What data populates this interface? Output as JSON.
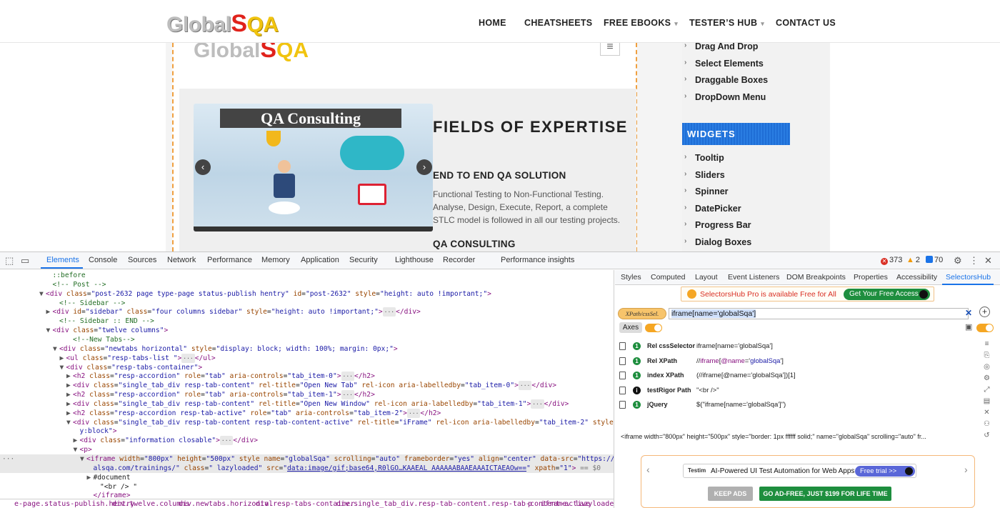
{
  "site": {
    "logo": {
      "part1": "Global",
      "part2": "S",
      "part3": "QA"
    },
    "nav": [
      {
        "label": "HOME",
        "dropdown": false
      },
      {
        "label": "CHEATSHEETS",
        "dropdown": false
      },
      {
        "label": "FREE EBOOKS",
        "dropdown": true
      },
      {
        "label": "TESTER’S HUB",
        "dropdown": true
      },
      {
        "label": "CONTACT US",
        "dropdown": false
      }
    ],
    "menu_glyph": "≡",
    "slider_title": "QA Consulting",
    "slider_prev": "‹",
    "slider_next": "›",
    "heading_fields": "FIELDS OF EXPERTISE",
    "heading_end": "END TO END QA SOLUTION",
    "para_end": "Functional Testing to Non-Functional Testing. Analyse, Design, Execute, Report, a complete STLC model is followed in all our testing projects.",
    "heading_qac": "QA CONSULTING",
    "sidebar_items_top": [
      "Drag And Drop",
      "Select Elements",
      "Draggable Boxes",
      "DropDown Menu"
    ],
    "widgets_heading": "WIDGETS",
    "sidebar_items_widgets": [
      "Tooltip",
      "Sliders",
      "Spinner",
      "DatePicker",
      "Progress Bar",
      "Dialog Boxes"
    ]
  },
  "devtools": {
    "tabs": [
      "Elements",
      "Console",
      "Sources",
      "Network",
      "Performance",
      "Memory",
      "Application",
      "Security",
      "Lighthouse",
      "Recorder",
      "Performance insights"
    ],
    "active_tab": "Elements",
    "errors": "373",
    "warnings": "2",
    "infos": "70",
    "code_lines": [
      {
        "indent": 7,
        "tri": "",
        "html": "<span class='cm'>::before</span>"
      },
      {
        "indent": 7,
        "tri": "",
        "html": "<span class='cm'>&lt;!-- Post --&gt;</span>"
      },
      {
        "indent": 6,
        "tri": "▼",
        "html": "<span class='tg'>&lt;div</span> <span class='an'>class</span>=<span class='av'>\"post-2632 page type-page status-publish hentry\"</span> <span class='an'>id</span>=<span class='av'>\"post-2632\"</span> <span class='an'>style</span>=<span class='av'>\"height: auto !important;\"</span><span class='tg'>&gt;</span>"
      },
      {
        "indent": 8,
        "tri": "",
        "html": "<span class='cm'>&lt;!-- Sidebar --&gt;</span>"
      },
      {
        "indent": 7,
        "tri": "▶",
        "html": "<span class='tg'>&lt;div</span> <span class='an'>id</span>=<span class='av'>\"sidebar\"</span> <span class='an'>class</span>=<span class='av'>\"four columns sidebar\"</span> <span class='an'>style</span>=<span class='av'>\"height: auto !important;\"</span><span class='tg'>&gt;</span><span class='el-dots'>···</span><span class='tg'>&lt;/div&gt;</span>"
      },
      {
        "indent": 8,
        "tri": "",
        "html": "<span class='cm'>&lt;!-- Sidebar :: END --&gt;</span>"
      },
      {
        "indent": 7,
        "tri": "▼",
        "html": "<span class='tg'>&lt;div</span> <span class='an'>class</span>=<span class='av'>\"twelve columns\"</span><span class='tg'>&gt;</span>"
      },
      {
        "indent": 10,
        "tri": "",
        "html": "<span class='cm'>&lt;!--New Tabs--&gt;</span>"
      },
      {
        "indent": 8,
        "tri": "▼",
        "html": "<span class='tg'>&lt;div</span> <span class='an'>class</span>=<span class='av'>\"newtabs horizontal\"</span> <span class='an'>style</span>=<span class='av'>\"display: block; width: 100%; margin: 0px;\"</span><span class='tg'>&gt;</span>"
      },
      {
        "indent": 9,
        "tri": "▶",
        "html": "<span class='tg'>&lt;ul</span> <span class='an'>class</span>=<span class='av'>\"resp-tabs-list \"</span><span class='tg'>&gt;</span><span class='el-dots'>···</span><span class='tg'>&lt;/ul&gt;</span>"
      },
      {
        "indent": 9,
        "tri": "▼",
        "html": "<span class='tg'>&lt;div</span> <span class='an'>class</span>=<span class='av'>\"resp-tabs-container\"</span><span class='tg'>&gt;</span>"
      },
      {
        "indent": 10,
        "tri": "▶",
        "html": "<span class='tg'>&lt;h2</span> <span class='an'>class</span>=<span class='av'>\"resp-accordion\"</span> <span class='an'>role</span>=<span class='av'>\"tab\"</span> <span class='an'>aria-controls</span>=<span class='av'>\"tab_item-0\"</span><span class='tg'>&gt;</span><span class='el-dots'>···</span><span class='tg'>&lt;/h2&gt;</span>"
      },
      {
        "indent": 10,
        "tri": "▶",
        "html": "<span class='tg'>&lt;div</span> <span class='an'>class</span>=<span class='av'>\"single_tab_div resp-tab-content\"</span> <span class='an'>rel-title</span>=<span class='av'>\"Open New Tab\"</span> <span class='an'>rel-icon</span> <span class='an'>aria-labelledby</span>=<span class='av'>\"tab_item-0\"</span><span class='tg'>&gt;</span><span class='el-dots'>···</span><span class='tg'>&lt;/div&gt;</span>"
      },
      {
        "indent": 10,
        "tri": "▶",
        "html": "<span class='tg'>&lt;h2</span> <span class='an'>class</span>=<span class='av'>\"resp-accordion\"</span> <span class='an'>role</span>=<span class='av'>\"tab\"</span> <span class='an'>aria-controls</span>=<span class='av'>\"tab_item-1\"</span><span class='tg'>&gt;</span><span class='el-dots'>···</span><span class='tg'>&lt;/h2&gt;</span>"
      },
      {
        "indent": 10,
        "tri": "▶",
        "html": "<span class='tg'>&lt;div</span> <span class='an'>class</span>=<span class='av'>\"single_tab_div resp-tab-content\"</span> <span class='an'>rel-title</span>=<span class='av'>\"Open New Window\"</span> <span class='an'>rel-icon</span> <span class='an'>aria-labelledby</span>=<span class='av'>\"tab_item-1\"</span><span class='tg'>&gt;</span><span class='el-dots'>···</span><span class='tg'>&lt;/div&gt;</span>"
      },
      {
        "indent": 10,
        "tri": "▶",
        "html": "<span class='tg'>&lt;h2</span> <span class='an'>class</span>=<span class='av'>\"resp-accordion resp-tab-active\"</span> <span class='an'>role</span>=<span class='av'>\"tab\"</span> <span class='an'>aria-controls</span>=<span class='av'>\"tab_item-2\"</span><span class='tg'>&gt;</span><span class='el-dots'>···</span><span class='tg'>&lt;/h2&gt;</span>"
      },
      {
        "indent": 10,
        "tri": "▼",
        "html": "<span class='tg'>&lt;div</span> <span class='an'>class</span>=<span class='av'>\"single_tab_div resp-tab-content resp-tab-content-active\"</span> <span class='an'>rel-title</span>=<span class='av'>\"iFrame\"</span> <span class='an'>rel-icon</span> <span class='an'>aria-labelledby</span>=<span class='av'>\"tab_item-2\"</span> <span class='an'>style</span>=<span class='av'>\"displa</span>"
      },
      {
        "indent": 11,
        "tri": "",
        "html": "<span class='av'>y:block\"</span><span class='tg'>&gt;</span>"
      },
      {
        "indent": 11,
        "tri": "▶",
        "html": "<span class='tg'>&lt;div</span> <span class='an'>class</span>=<span class='av'>\"information closable\"</span><span class='tg'>&gt;</span><span class='el-dots'>···</span><span class='tg'>&lt;/div&gt;</span>"
      },
      {
        "indent": 11,
        "tri": "▼",
        "html": "<span class='tg'>&lt;p&gt;</span>"
      },
      {
        "indent": 12,
        "tri": "▼",
        "sel": true,
        "html": "<span class='tg'>&lt;iframe</span> <span class='an'>width</span>=<span class='av'>\"800px\"</span> <span class='an'>height</span>=<span class='av'>\"500px\"</span> <span class='an'>style</span> <span class='an'>name</span>=<span class='av'>\"globalSqa\"</span> <span class='an'>scrolling</span>=<span class='av'>\"auto\"</span> <span class='an'>frameborder</span>=<span class='av'>\"yes\"</span> <span class='an'>align</span>=<span class='av'>\"center\"</span> <span class='an'>data-src</span>=<span class='av'>\"https://www.glob</span>"
      },
      {
        "indent": 13,
        "tri": "",
        "sel": true,
        "html": "<span class='av'>alsqa.com/trainings/\"</span> <span class='an'>class</span>=<span class='av'>\" lazyloaded\"</span> <span class='an'>src</span>=<span class='av'>\"</span><span class='lk'>data:image/gif;base64,R0lGO…KAAEAL AAAAAABAAEAAAICTAEAOw==</span><span class='av'>\"</span> <span class='an'>xpath</span>=<span class='av'>\"1\"</span><span class='tg'>&gt;</span> <span style='color:#777'>== $0</span>"
      },
      {
        "indent": 13,
        "tri": "▶",
        "html": "<span style='color:#222'>#document</span>"
      },
      {
        "indent": 14,
        "tri": "",
        "html": "<span style='color:#222'>\"&lt;br /&gt; \"</span>"
      },
      {
        "indent": 13,
        "tri": "",
        "html": "<span class='tg'>&lt;/iframe&gt;</span>"
      }
    ],
    "breadcrumbs": [
      "e-page.status-publish.hentry",
      "div.twelve.columns",
      "div.newtabs.horizontal",
      "div.resp-tabs-container",
      "div.single_tab_div.resp-tab-content.resp-tab-content-active",
      "p",
      "iframe. lazyloaded"
    ],
    "side_tabs": [
      "Styles",
      "Computed",
      "Layout",
      "Event Listeners",
      "DOM Breakpoints",
      "Properties",
      "Accessibility",
      "SelectorsHub"
    ],
    "active_side_tab": "SelectorsHub",
    "selectorshub": {
      "promo_text": "SelectorsHub Pro is available Free for All",
      "promo_button": "Get Your Free Access",
      "xpath_badge": "XPath/cssSel.",
      "xpath_value": "iframe[name='globalSqa']",
      "axes_label": "Axes",
      "rows": [
        {
          "type": "Rel cssSelector",
          "badge": "1",
          "value_html": "iframe[name='globalSqa']"
        },
        {
          "type": "Rel XPath",
          "badge": "1",
          "value_html": "//<span class='pu'>iframe</span>[<span class='pu'>@name</span>='<span class='bl'>globalSqa</span>']"
        },
        {
          "type": "index XPath",
          "badge": "1",
          "value_html": "(//iframe[@name='globalSqa'])[1]"
        },
        {
          "type": "testRigor Path",
          "badge": "i",
          "value_html": "\"&lt;br /&gt;\""
        },
        {
          "type": "jQuery",
          "badge": "1",
          "value_html": "$(\"iframe[name='globalSqa']\")"
        }
      ],
      "outer_html": "<iframe width=\"800px\" height=\"500px\" style=\"border: 1px ffffff solid;\" name=\"globalSqa\" scrolling=\"auto\" fr...",
      "ad_logo": "Testim",
      "ad_text": "AI-Powered UI Test Automation for Web Apps",
      "ad_cta": "Free trial >>",
      "keep_ads": "KEEP ADS",
      "go_adfree": "GO AD-FREE, JUST $199 FOR LIFE TIME"
    }
  }
}
